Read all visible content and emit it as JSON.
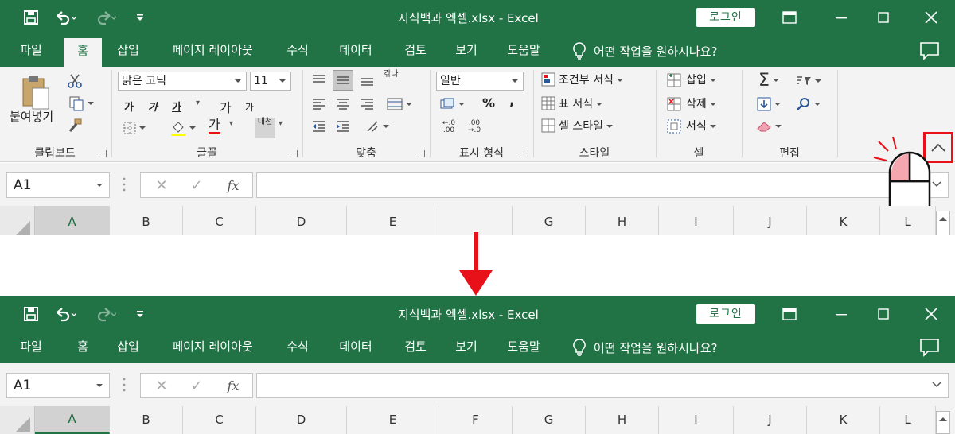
{
  "window": {
    "title": "지식백과 엑셀.xlsx  -  Excel",
    "login_label": "로그인"
  },
  "tabs": [
    "파일",
    "홈",
    "삽입",
    "페이지 레이아웃",
    "수식",
    "데이터",
    "검토",
    "보기",
    "도움말"
  ],
  "active_tab_top": "홈",
  "tell_me": "어떤 작업을 원하시나요?",
  "ribbon": {
    "clipboard": {
      "paste_label": "붙여넣기",
      "group_label": "클립보드"
    },
    "font": {
      "font_name": "맑은 고딕",
      "font_size": "11",
      "bold": "가",
      "italic": "가",
      "underline": "가",
      "grow": "가",
      "shrink": "가",
      "font_color_glyph": "가",
      "phonetic": "내천",
      "group_label": "글꼴"
    },
    "alignment": {
      "wrap_glyph": "갂나",
      "group_label": "맞춤"
    },
    "number": {
      "format": "일반",
      "percent": "%",
      "comma": ",",
      "group_label": "표시 형식"
    },
    "styles": {
      "conditional": "조건부 서식",
      "table_format": "표 서식",
      "cell_styles": "셀 스타일",
      "group_label": "스타일"
    },
    "cells": {
      "insert": "삽입",
      "delete": "삭제",
      "format": "서식",
      "group_label": "셀"
    },
    "editing": {
      "group_label": "편집"
    }
  },
  "formula_bar": {
    "name_box": "A1",
    "fx": "fx"
  },
  "columns_top": [
    "A",
    "B",
    "C",
    "D",
    "E",
    "G",
    "H",
    "I",
    "J",
    "K",
    "L"
  ],
  "columns_bottom": [
    "A",
    "B",
    "C",
    "D",
    "E",
    "F",
    "G",
    "H",
    "I",
    "J",
    "K",
    "L"
  ],
  "colors": {
    "excel_green": "#217346",
    "highlight_red": "#e8111a"
  }
}
